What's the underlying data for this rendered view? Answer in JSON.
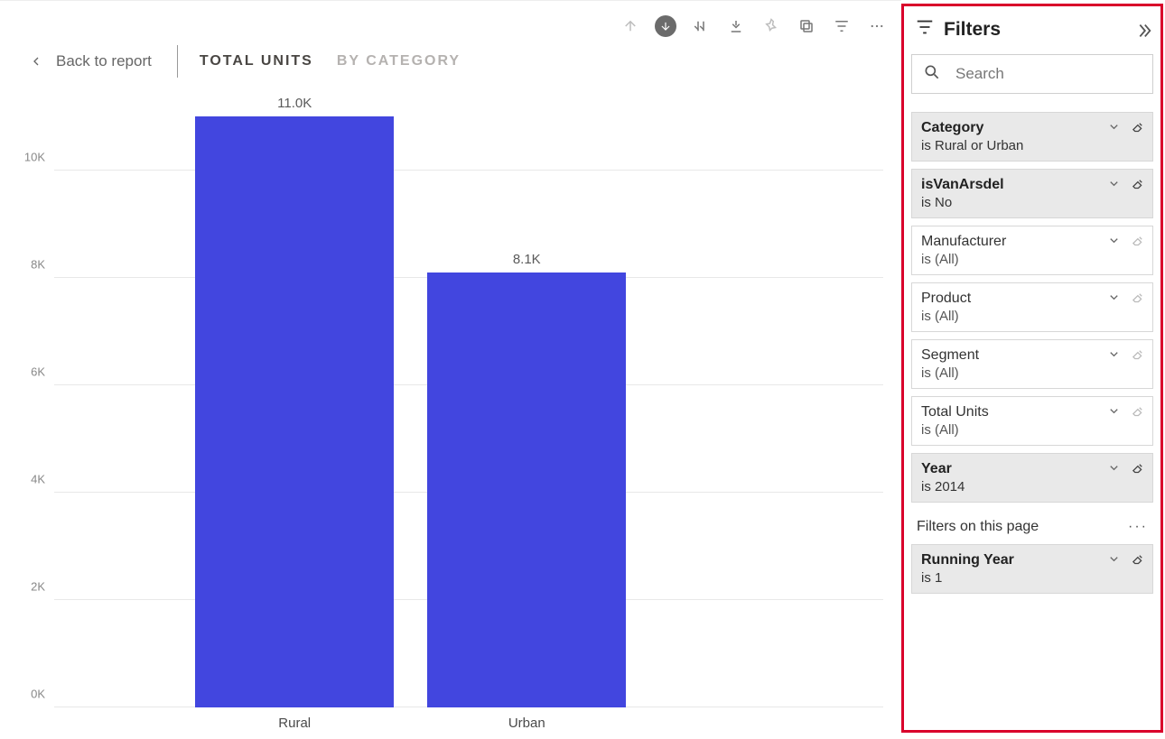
{
  "toolbar": {
    "back_label": "Back to report",
    "tabs": [
      {
        "label": "TOTAL UNITS",
        "active": true
      },
      {
        "label": "BY CATEGORY",
        "active": false
      }
    ]
  },
  "chart_data": {
    "type": "bar",
    "categories": [
      "Rural",
      "Urban"
    ],
    "values": [
      11000,
      8100
    ],
    "value_labels": [
      "11.0K",
      "8.1K"
    ],
    "title": "",
    "xlabel": "",
    "ylabel": "",
    "ylim": [
      0,
      11000
    ],
    "yticks": [
      {
        "v": 0,
        "label": "0K"
      },
      {
        "v": 2000,
        "label": "2K"
      },
      {
        "v": 4000,
        "label": "4K"
      },
      {
        "v": 6000,
        "label": "6K"
      },
      {
        "v": 8000,
        "label": "8K"
      },
      {
        "v": 10000,
        "label": "10K"
      }
    ],
    "bar_color": "#4246df"
  },
  "filters": {
    "title": "Filters",
    "search_placeholder": "Search",
    "cards": [
      {
        "title": "Category",
        "subtitle": "is Rural or Urban",
        "active": true
      },
      {
        "title": "isVanArsdel",
        "subtitle": "is No",
        "active": true
      },
      {
        "title": "Manufacturer",
        "subtitle": "is (All)",
        "active": false
      },
      {
        "title": "Product",
        "subtitle": "is (All)",
        "active": false
      },
      {
        "title": "Segment",
        "subtitle": "is (All)",
        "active": false
      },
      {
        "title": "Total Units",
        "subtitle": "is (All)",
        "active": false
      },
      {
        "title": "Year",
        "subtitle": "is 2014",
        "active": true
      }
    ],
    "section_label": "Filters on this page",
    "page_cards": [
      {
        "title": "Running Year",
        "subtitle": "is 1",
        "active": true
      }
    ]
  }
}
